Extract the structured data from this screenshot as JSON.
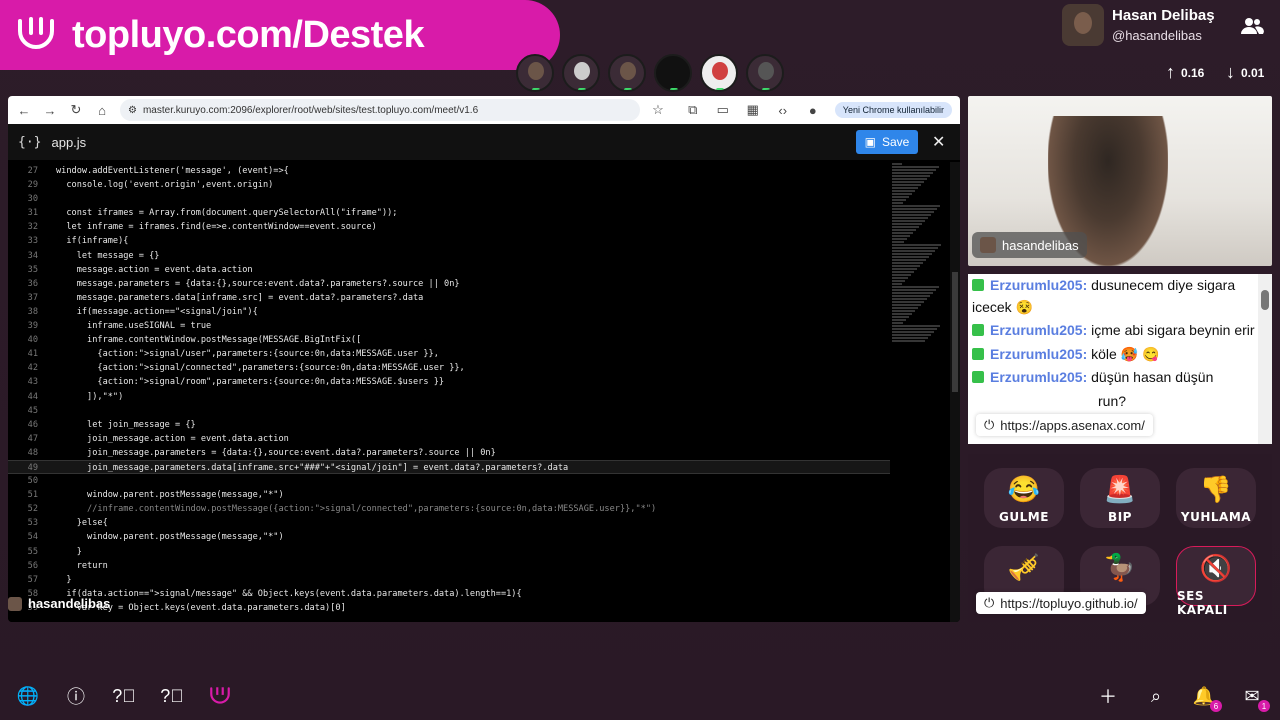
{
  "banner": {
    "text": "topluyo.com/Destek",
    "visible_text": "topluyo.com/Dest"
  },
  "header": {
    "display_name": "Hasan Delibaş",
    "handle": "@hasandelibas",
    "upload_rate": "0.16",
    "download_rate": "0.01"
  },
  "browser": {
    "url": "master.kuruyo.com:2096/explorer/root/web/sites/test.topluyo.com/meet/v1.6",
    "profile_label": "Yeni Chrome kullanılabilir",
    "file_name": "app.js",
    "file_icon": "{·}",
    "save_label": "Save"
  },
  "code_lines": [
    {
      "n": "27",
      "t": "window.addEventListener('message', (event)=>{"
    },
    {
      "n": "29",
      "t": "  console.log('event.origin',event.origin)"
    },
    {
      "n": "30",
      "t": ""
    },
    {
      "n": "31",
      "t": "  const iframes = Array.from(document.querySelectorAll(\"iframe\"));"
    },
    {
      "n": "32",
      "t": "  let inframe = iframes.find(e=>e.contentWindow==event.source)"
    },
    {
      "n": "33",
      "t": "  if(inframe){"
    },
    {
      "n": "34",
      "t": "    let message = {}"
    },
    {
      "n": "35",
      "t": "    message.action = event.data.action"
    },
    {
      "n": "36",
      "t": "    message.parameters = {data:{},source:event.data?.parameters?.source || 0n}"
    },
    {
      "n": "37",
      "t": "    message.parameters.data[inframe.src] = event.data?.parameters?.data"
    },
    {
      "n": "38",
      "t": "    if(message.action==\"<signal/join\"){"
    },
    {
      "n": "39",
      "t": "      inframe.useSIGNAL = true"
    },
    {
      "n": "40",
      "t": "      inframe.contentWindow.postMessage(MESSAGE.BigIntFix(["
    },
    {
      "n": "41",
      "t": "        {action:\">signal/user\",parameters:{source:0n,data:MESSAGE.user }},"
    },
    {
      "n": "42",
      "t": "        {action:\">signal/connected\",parameters:{source:0n,data:MESSAGE.user }},"
    },
    {
      "n": "43",
      "t": "        {action:\">signal/room\",parameters:{source:0n,data:MESSAGE.$users }}"
    },
    {
      "n": "44",
      "t": "      ]),\"*\")"
    },
    {
      "n": "45",
      "t": ""
    },
    {
      "n": "46",
      "t": "      let join_message = {}"
    },
    {
      "n": "47",
      "t": "      join_message.action = event.data.action"
    },
    {
      "n": "48",
      "t": "      join_message.parameters = {data:{},source:event.data?.parameters?.source || 0n}"
    },
    {
      "n": "49",
      "t": "      join_message.parameters.data[inframe.src+\"###\"+\"<signal/join\"] = event.data?.parameters?.data"
    },
    {
      "n": "50",
      "t": ""
    },
    {
      "n": "51",
      "t": "      window.parent.postMessage(message,\"*\")"
    },
    {
      "n": "52",
      "t": "      //inframe.contentWindow.postMessage({action:\">signal/connected\",parameters:{source:0n,data:MESSAGE.user}},\"*\")"
    },
    {
      "n": "53",
      "t": "    }else{"
    },
    {
      "n": "54",
      "t": "      window.parent.postMessage(message,\"*\")"
    },
    {
      "n": "55",
      "t": "    }"
    },
    {
      "n": "56",
      "t": "    return"
    },
    {
      "n": "57",
      "t": "  }"
    },
    {
      "n": "58",
      "t": "  if(data.action==\">signal/message\" && Object.keys(event.data.parameters.data).length==1){"
    },
    {
      "n": "59",
      "t": "    var key = Object.keys(event.data.parameters.data)[0]"
    }
  ],
  "name_tag": "hasandelibas",
  "webcam": {
    "label": "hasandelibas"
  },
  "chat": {
    "messages": [
      {
        "user": "Erzurumlu205:",
        "text": " dusunecem diye sigara icecek 😵"
      },
      {
        "user": "Erzurumlu205:",
        "text": " içme abi sigara beynin erir"
      },
      {
        "user": "Erzurumlu205:",
        "text": " köle 🥵 😋"
      },
      {
        "user": "Erzurumlu205:",
        "text": " düşün hasan düşün"
      },
      {
        "user": "",
        "text": "run?"
      }
    ],
    "link_tip": "https://apps.asenax.com/"
  },
  "reactions": [
    {
      "emoji": "😂",
      "label": "GULME"
    },
    {
      "emoji": "🚨",
      "label": "BIP"
    },
    {
      "emoji": "👎",
      "label": "YUHLAMA"
    },
    {
      "emoji": "🎺",
      "label": ""
    },
    {
      "emoji": "🦆",
      "label": ""
    },
    {
      "emoji": "🔇",
      "label": "SES KAPALI"
    }
  ],
  "reactions_link_tip": "https://topluyo.github.io/",
  "bottom": {
    "notif_count": "6",
    "mail_count": "1"
  },
  "colors": {
    "brand": "#d81ba9",
    "save": "#2f86ea",
    "chat_user": "#5a7ee0"
  }
}
